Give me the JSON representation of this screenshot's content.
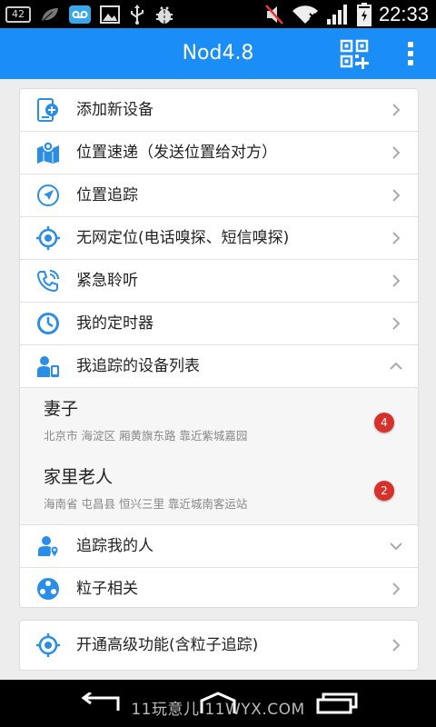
{
  "status_bar": {
    "notif_number": "42",
    "time": "22:33"
  },
  "app_bar": {
    "title": "Nod4.8"
  },
  "menu": [
    {
      "label": "添加新设备",
      "icon": "add-device-icon"
    },
    {
      "label": "位置速递（发送位置给对方）",
      "icon": "map-icon"
    },
    {
      "label": "位置追踪",
      "icon": "navigation-icon"
    },
    {
      "label": "无网定位(电话嗅探、短信嗅探)",
      "icon": "crosshair-icon"
    },
    {
      "label": "紧急聆听",
      "icon": "phone-icon"
    },
    {
      "label": "我的定时器",
      "icon": "clock-icon"
    },
    {
      "label": "我追踪的设备列表",
      "icon": "person-device-icon"
    }
  ],
  "tracked_devices": [
    {
      "name": "妻子",
      "address": "北京市 海淀区 厢黄旗东路 靠近紫城嘉园",
      "badge": "4"
    },
    {
      "name": "家里老人",
      "address": "海南省 屯昌县 恒兴三里 靠近城南客运站",
      "badge": "2"
    }
  ],
  "menu_after": [
    {
      "label": "追踪我的人",
      "icon": "person-location-icon"
    },
    {
      "label": "粒子相关",
      "icon": "particle-icon"
    }
  ],
  "upgrade": {
    "label": "开通高级功能(含粒子追踪)",
    "icon": "crosshair-icon"
  },
  "nav_bar": {
    "watermark": "11玩意儿 11WYX.COM"
  },
  "colors": {
    "accent": "#1a8ef6",
    "badge": "#d8302b",
    "icon": "#2b8ee6"
  }
}
